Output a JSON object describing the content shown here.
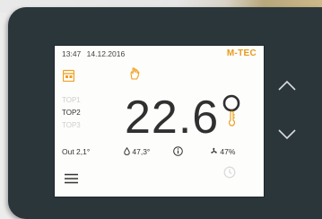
{
  "status_bar": {
    "time": "13:47",
    "date": "14.12.2016"
  },
  "brand": "M-TEC",
  "modes": [
    {
      "label": "TOP1",
      "active": false
    },
    {
      "label": "TOP2",
      "active": true
    },
    {
      "label": "TOP3",
      "active": false
    }
  ],
  "temperature": {
    "value": "22.6",
    "unit": "°"
  },
  "readings": {
    "outdoor": "Out 2,1°",
    "water_temp": "47,3°",
    "humidity": "47%"
  },
  "icons": [
    "calendar-icon",
    "hand-icon",
    "degree-ring",
    "thermometer-icon",
    "drop-icon",
    "info-icon",
    "fan-icon",
    "menu-icon",
    "clock-icon",
    "chevron-up-icon",
    "chevron-down-icon"
  ],
  "colors": {
    "bezel": "#2b363a",
    "accent": "#f0a020",
    "screen": "#fdfdfc"
  }
}
